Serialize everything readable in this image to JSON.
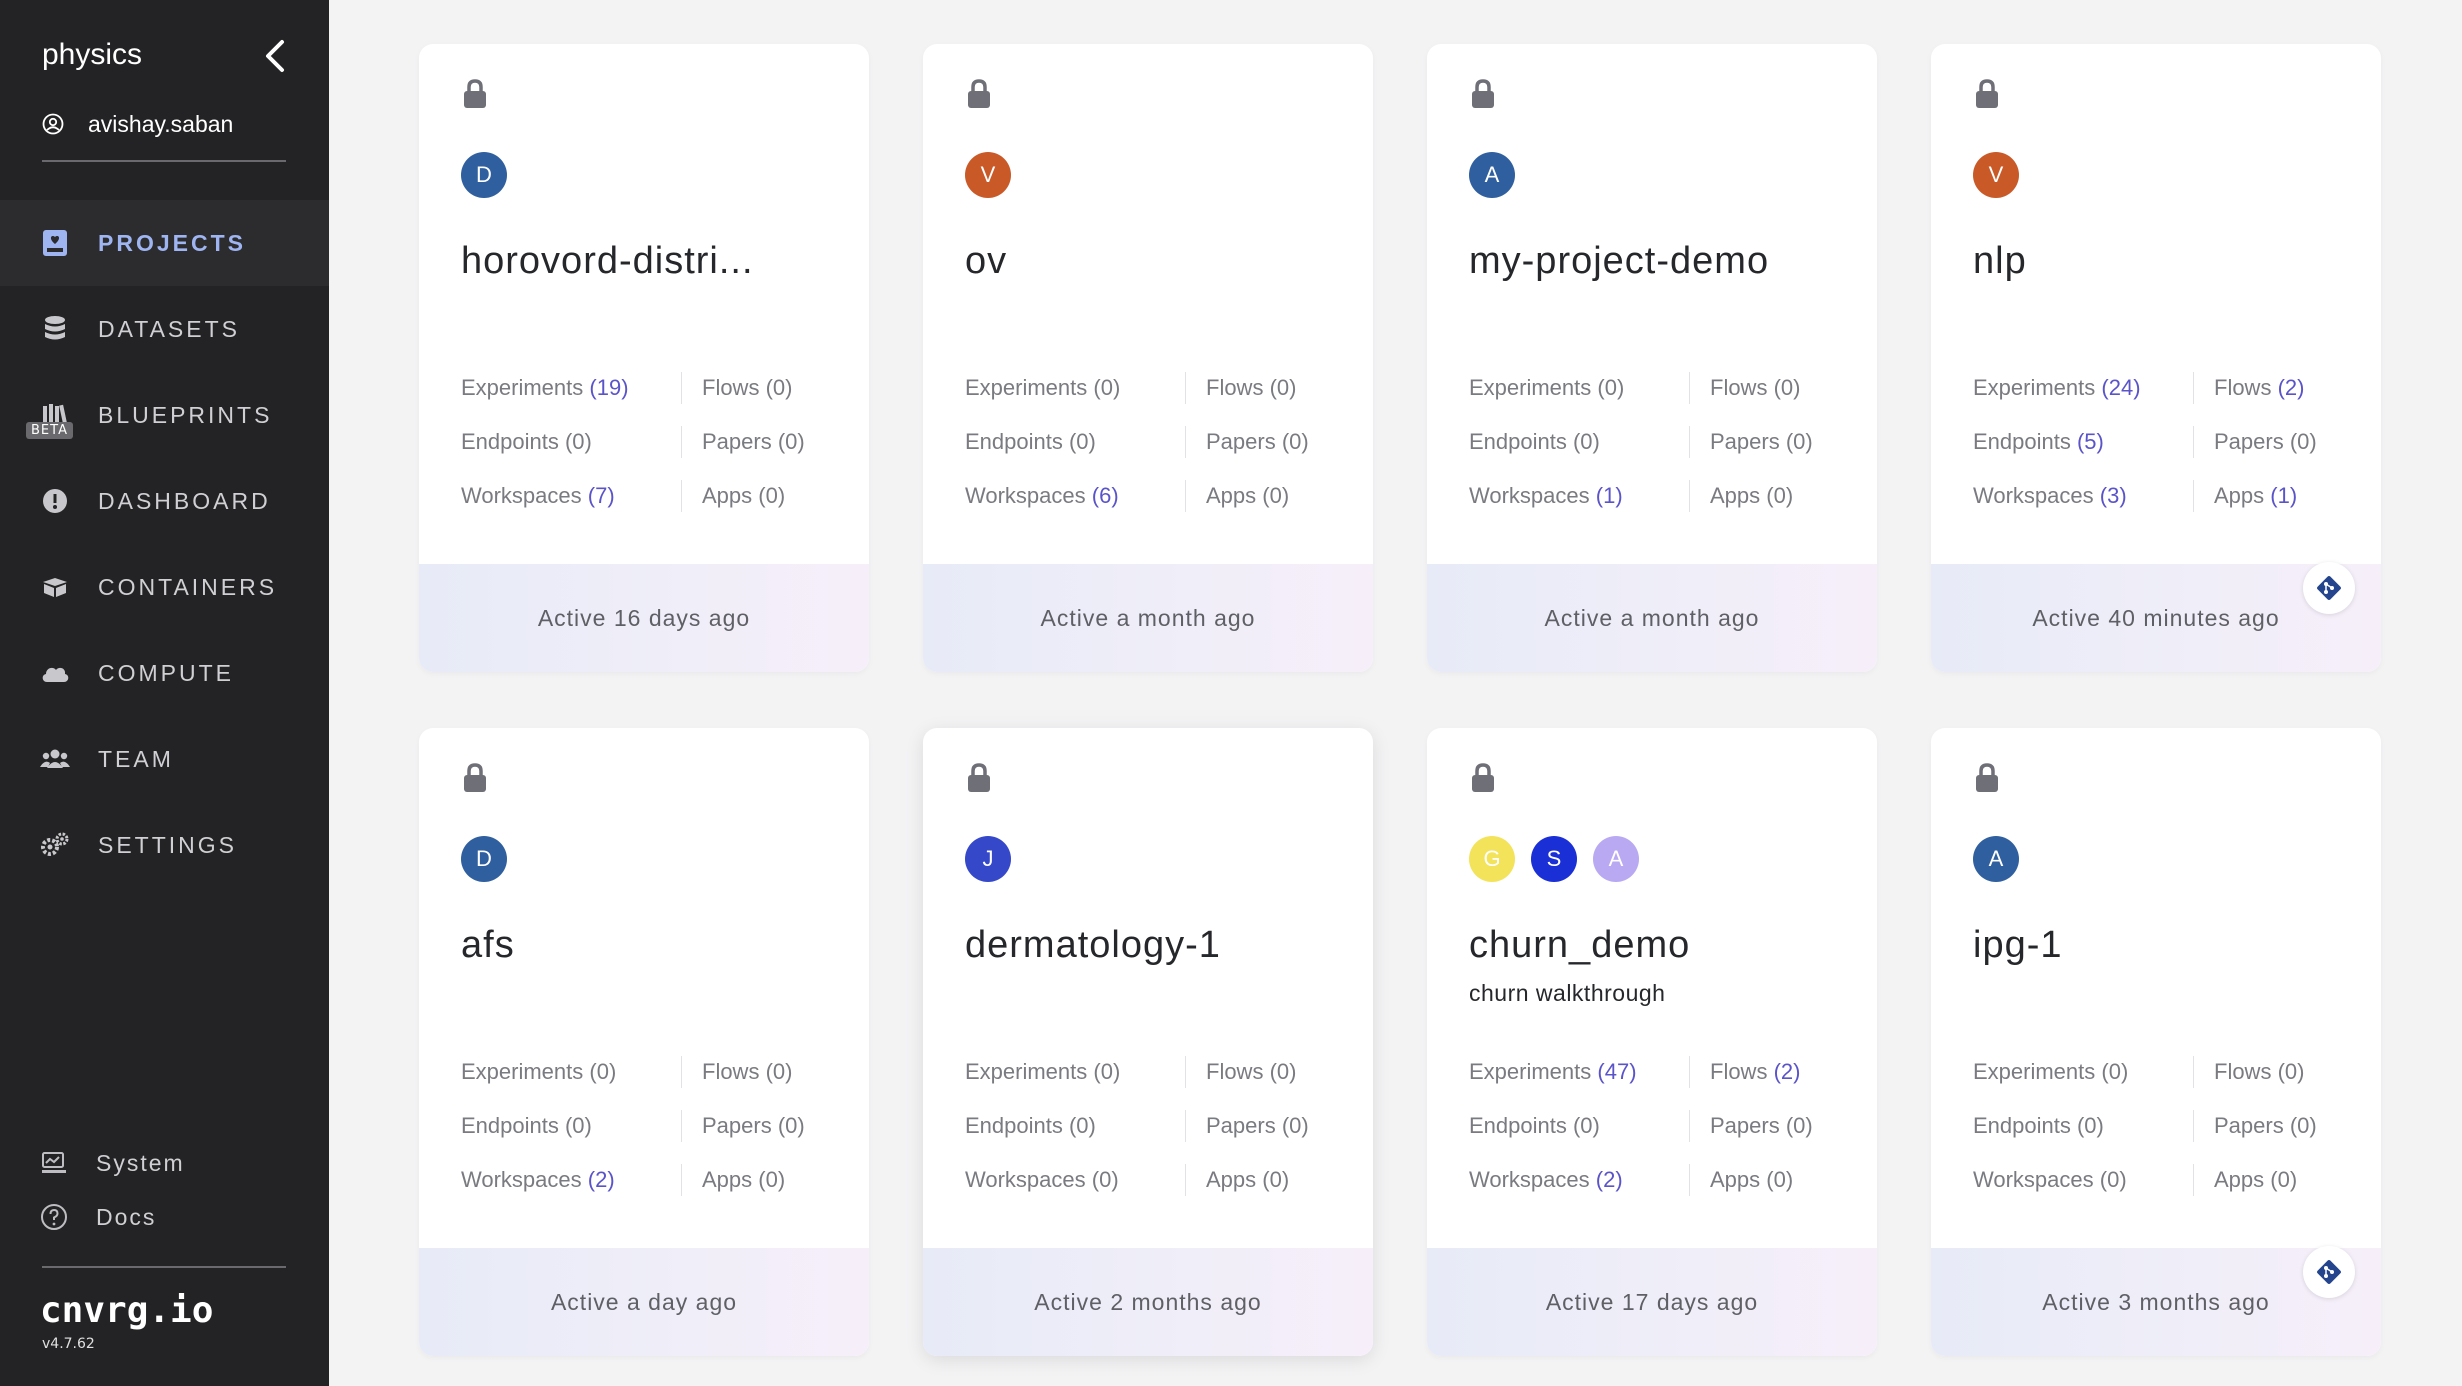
{
  "sidebar": {
    "org": "physics",
    "user": "avishay.saban",
    "nav": [
      {
        "label": "PROJECTS",
        "icon": "projects-icon",
        "active": true
      },
      {
        "label": "DATASETS",
        "icon": "datasets-icon"
      },
      {
        "label": "BLUEPRINTS",
        "icon": "blueprints-icon",
        "badge": "BETA"
      },
      {
        "label": "DASHBOARD",
        "icon": "dashboard-icon"
      },
      {
        "label": "CONTAINERS",
        "icon": "containers-icon"
      },
      {
        "label": "COMPUTE",
        "icon": "cloud-icon"
      },
      {
        "label": "TEAM",
        "icon": "team-icon"
      },
      {
        "label": "SETTINGS",
        "icon": "settings-icon"
      }
    ],
    "bottom": [
      {
        "label": "System",
        "icon": "system-icon"
      },
      {
        "label": "Docs",
        "icon": "help-icon"
      }
    ],
    "brand": "cnvrg.io",
    "version": "v4.7.62"
  },
  "colors": {
    "sidebar_bg": "#232325",
    "active_nav": "#9fb5f2",
    "count_link": "#5b54c9"
  },
  "projects": [
    {
      "title": "horovord-distri...",
      "desc": "",
      "avatars": [
        {
          "letter": "D",
          "color": "#2f5f9e"
        }
      ],
      "experiments": "Experiments",
      "experiments_count": "(19)",
      "experiments_link": true,
      "flows": "Flows",
      "flows_count": "(0)",
      "endpoints": "Endpoints",
      "endpoints_count": "(0)",
      "papers": "Papers",
      "papers_count": "(0)",
      "workspaces": "Workspaces",
      "workspaces_count": "(7)",
      "workspaces_link": true,
      "apps": "Apps",
      "apps_count": "(0)",
      "activity": "Active 16 days ago",
      "git": false
    },
    {
      "title": "ov",
      "desc": "",
      "avatars": [
        {
          "letter": "V",
          "color": "#c95a28"
        }
      ],
      "experiments": "Experiments",
      "experiments_count": "(0)",
      "flows": "Flows",
      "flows_count": "(0)",
      "endpoints": "Endpoints",
      "endpoints_count": "(0)",
      "papers": "Papers",
      "papers_count": "(0)",
      "workspaces": "Workspaces",
      "workspaces_count": "(6)",
      "workspaces_link": true,
      "apps": "Apps",
      "apps_count": "(0)",
      "activity": "Active a month ago",
      "git": false
    },
    {
      "title": "my-project-demo",
      "desc": "",
      "avatars": [
        {
          "letter": "A",
          "color": "#2f5f9e"
        }
      ],
      "experiments": "Experiments",
      "experiments_count": "(0)",
      "flows": "Flows",
      "flows_count": "(0)",
      "endpoints": "Endpoints",
      "endpoints_count": "(0)",
      "papers": "Papers",
      "papers_count": "(0)",
      "workspaces": "Workspaces",
      "workspaces_count": "(1)",
      "workspaces_link": true,
      "apps": "Apps",
      "apps_count": "(0)",
      "activity": "Active a month ago",
      "git": false
    },
    {
      "title": "nlp",
      "desc": "",
      "avatars": [
        {
          "letter": "V",
          "color": "#c95a28"
        }
      ],
      "experiments": "Experiments",
      "experiments_count": "(24)",
      "experiments_link": true,
      "flows": "Flows",
      "flows_count": "(2)",
      "flows_link": true,
      "endpoints": "Endpoints",
      "endpoints_count": "(5)",
      "endpoints_link": true,
      "papers": "Papers",
      "papers_count": "(0)",
      "workspaces": "Workspaces",
      "workspaces_count": "(3)",
      "workspaces_link": true,
      "apps": "Apps",
      "apps_count": "(1)",
      "apps_link": true,
      "activity": "Active 40 minutes ago",
      "git": true
    },
    {
      "title": "afs",
      "desc": "",
      "avatars": [
        {
          "letter": "D",
          "color": "#2f5f9e"
        }
      ],
      "experiments": "Experiments",
      "experiments_count": "(0)",
      "flows": "Flows",
      "flows_count": "(0)",
      "endpoints": "Endpoints",
      "endpoints_count": "(0)",
      "papers": "Papers",
      "papers_count": "(0)",
      "workspaces": "Workspaces",
      "workspaces_count": "(2)",
      "workspaces_link": true,
      "apps": "Apps",
      "apps_count": "(0)",
      "activity": "Active a day ago",
      "git": false
    },
    {
      "title": "dermatology-1",
      "desc": "",
      "avatars": [
        {
          "letter": "J",
          "color": "#3548c9"
        }
      ],
      "experiments": "Experiments",
      "experiments_count": "(0)",
      "flows": "Flows",
      "flows_count": "(0)",
      "endpoints": "Endpoints",
      "endpoints_count": "(0)",
      "papers": "Papers",
      "papers_count": "(0)",
      "workspaces": "Workspaces",
      "workspaces_count": "(0)",
      "apps": "Apps",
      "apps_count": "(0)",
      "activity": "Active 2 months ago",
      "git": false,
      "elevated": true
    },
    {
      "title": "churn_demo",
      "desc": "churn walkthrough",
      "avatars": [
        {
          "letter": "G",
          "color": "#f3e35a"
        },
        {
          "letter": "S",
          "color": "#1a2fd6"
        },
        {
          "letter": "A",
          "color": "#b9a9f2"
        }
      ],
      "experiments": "Experiments",
      "experiments_count": "(47)",
      "experiments_link": true,
      "flows": "Flows",
      "flows_count": "(2)",
      "flows_link": true,
      "endpoints": "Endpoints",
      "endpoints_count": "(0)",
      "papers": "Papers",
      "papers_count": "(0)",
      "workspaces": "Workspaces",
      "workspaces_count": "(2)",
      "workspaces_link": true,
      "apps": "Apps",
      "apps_count": "(0)",
      "activity": "Active 17 days ago",
      "git": false
    },
    {
      "title": "ipg-1",
      "desc": "",
      "avatars": [
        {
          "letter": "A",
          "color": "#2f5f9e"
        }
      ],
      "experiments": "Experiments",
      "experiments_count": "(0)",
      "flows": "Flows",
      "flows_count": "(0)",
      "endpoints": "Endpoints",
      "endpoints_count": "(0)",
      "papers": "Papers",
      "papers_count": "(0)",
      "workspaces": "Workspaces",
      "workspaces_count": "(0)",
      "apps": "Apps",
      "apps_count": "(0)",
      "activity": "Active 3 months ago",
      "git": true
    }
  ]
}
